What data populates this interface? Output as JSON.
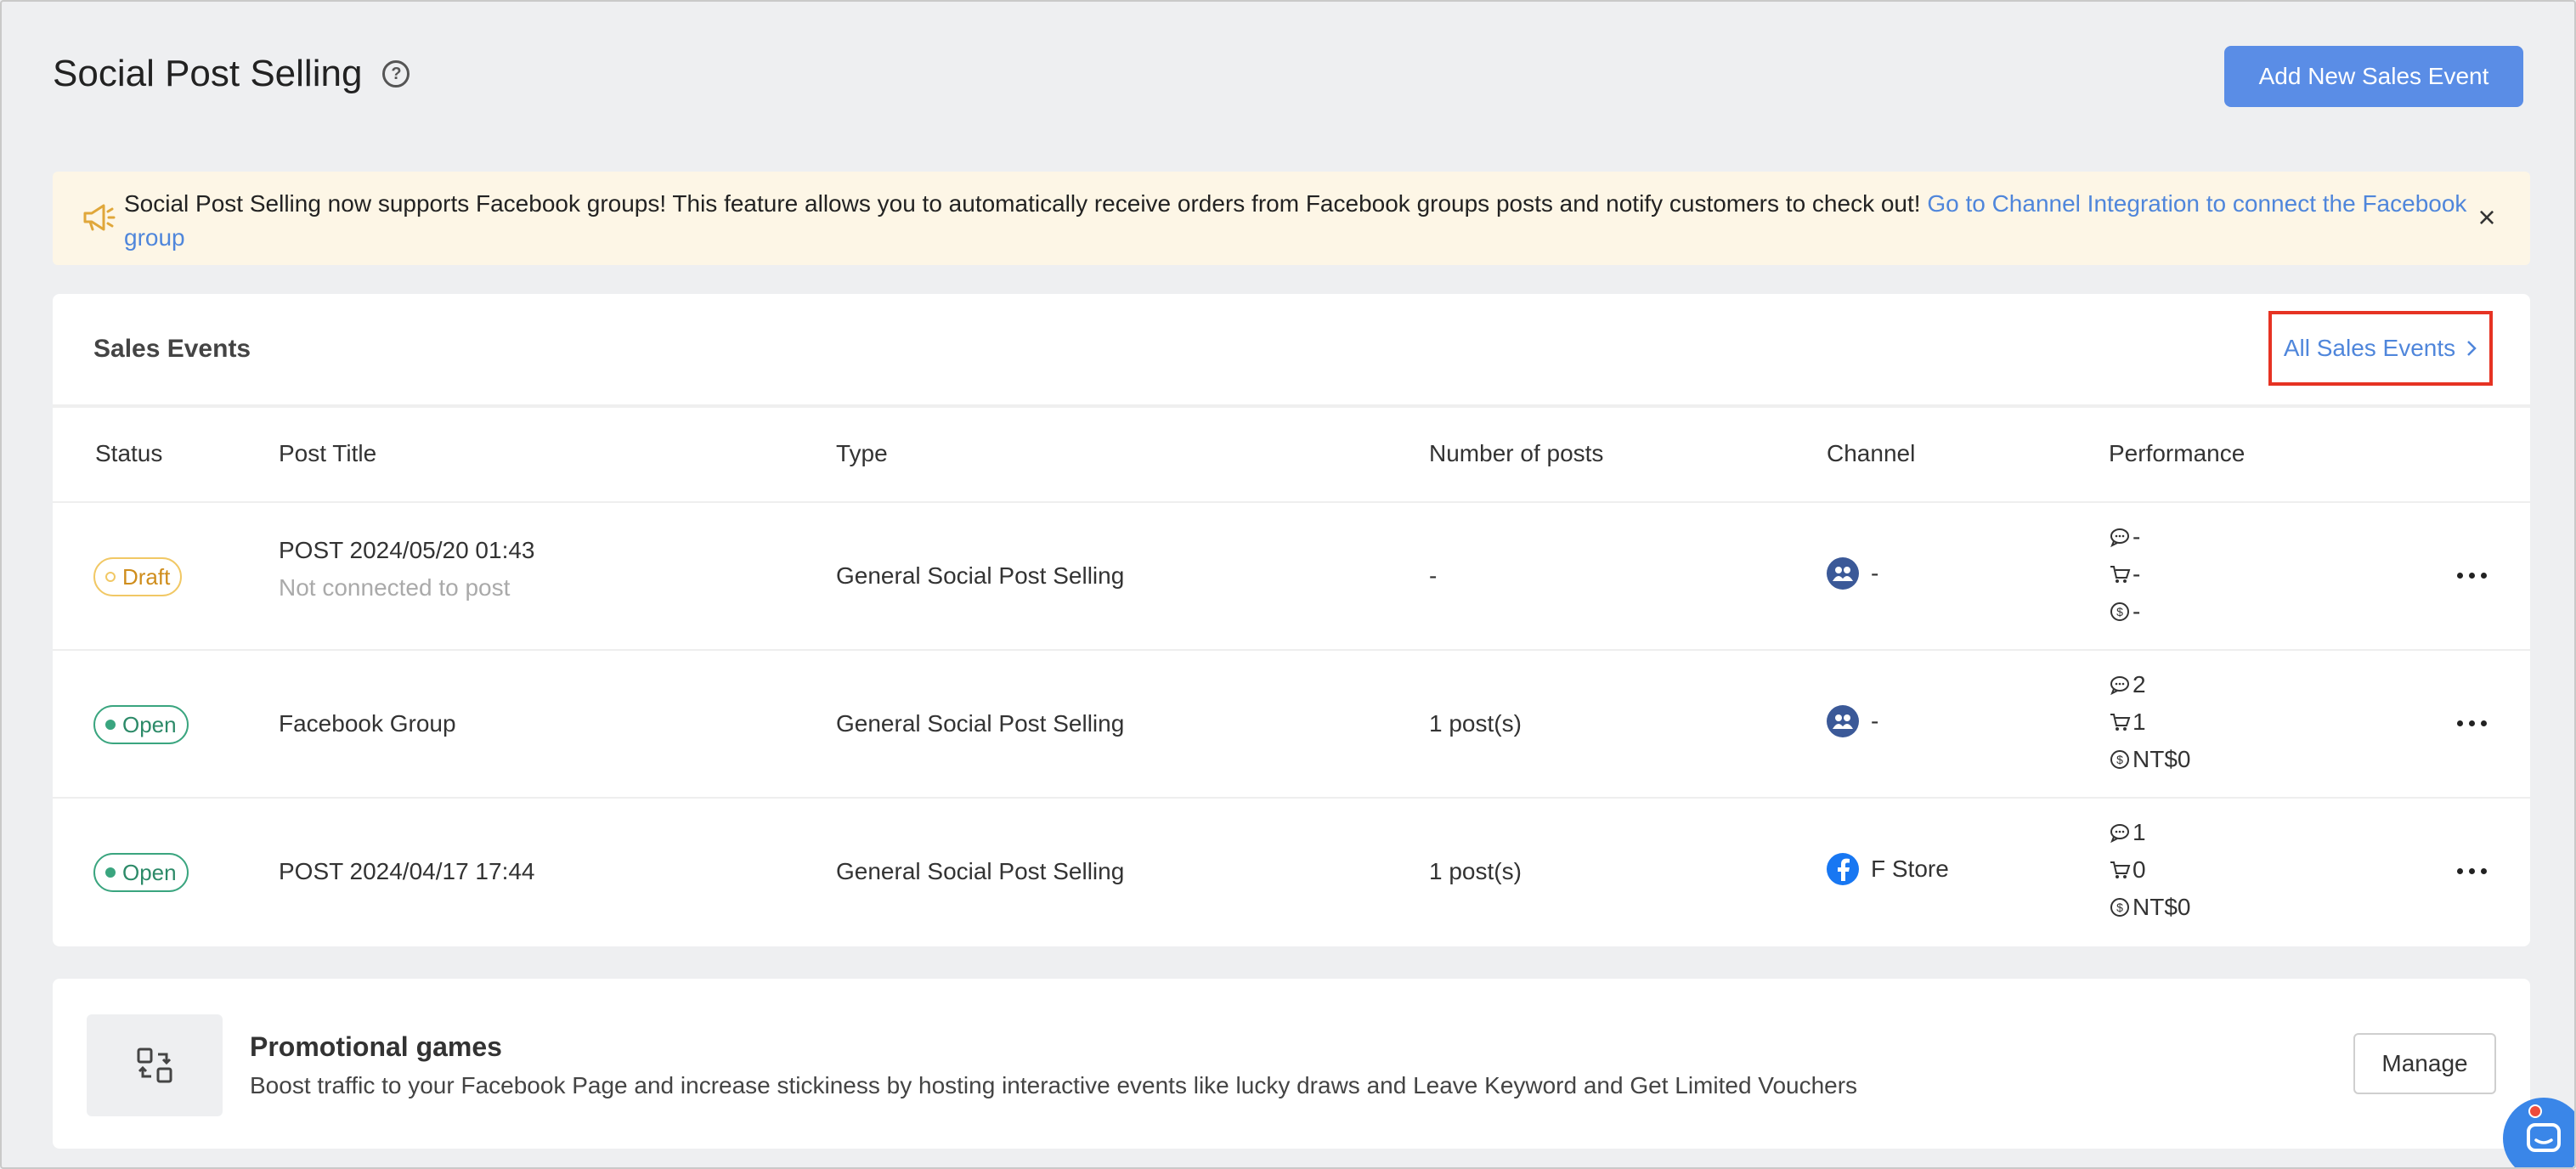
{
  "header": {
    "title": "Social Post Selling",
    "add_button": "Add New Sales Event"
  },
  "banner": {
    "text": "Social Post Selling now supports Facebook groups! This feature allows you to automatically receive orders from Facebook groups posts and notify customers to check out! ",
    "link": "Go to Channel Integration to connect the Facebook group",
    "close": "×"
  },
  "sales_events": {
    "title": "Sales Events",
    "all_link": "All Sales Events",
    "columns": {
      "status": "Status",
      "post_title": "Post Title",
      "type": "Type",
      "posts": "Number of posts",
      "channel": "Channel",
      "performance": "Performance"
    },
    "rows": [
      {
        "status": "Draft",
        "title": "POST 2024/05/20 01:43",
        "subtitle": "Not connected to post",
        "type": "General Social Post Selling",
        "posts": "-",
        "channel": "-",
        "comments": "-",
        "orders": "-",
        "revenue": "-"
      },
      {
        "status": "Open",
        "title": "Facebook Group",
        "subtitle": "",
        "type": "General Social Post Selling",
        "posts": "1 post(s)",
        "channel": "-",
        "comments": "2",
        "orders": "1",
        "revenue": "NT$0"
      },
      {
        "status": "Open",
        "title": "POST 2024/04/17 17:44",
        "subtitle": "",
        "type": "General Social Post Selling",
        "posts": "1 post(s)",
        "channel": "F Store",
        "comments": "1",
        "orders": "0",
        "revenue": "NT$0"
      }
    ]
  },
  "promo": {
    "title": "Promotional games",
    "description": "Boost traffic to your Facebook Page and increase stickiness by hosting interactive events like lucky draws and Leave Keyword and Get Limited Vouchers",
    "manage_button": "Manage"
  },
  "colors": {
    "primary": "#5a8de6",
    "link": "#4f86db",
    "highlight_border": "#e63323",
    "draft": "#cf8d1c",
    "open": "#2c8a68",
    "banner_bg": "#fdf6e6"
  },
  "icons": {
    "help": "help-circle-icon",
    "banner": "megaphone-icon",
    "group_channel": "facebook-group-icon",
    "page_channel": "facebook-icon",
    "comments": "comment-icon",
    "orders": "cart-icon",
    "revenue": "dollar-circle-icon",
    "more": "more-horizontal-icon",
    "promo": "swap-icon",
    "chat": "chat-icon"
  }
}
